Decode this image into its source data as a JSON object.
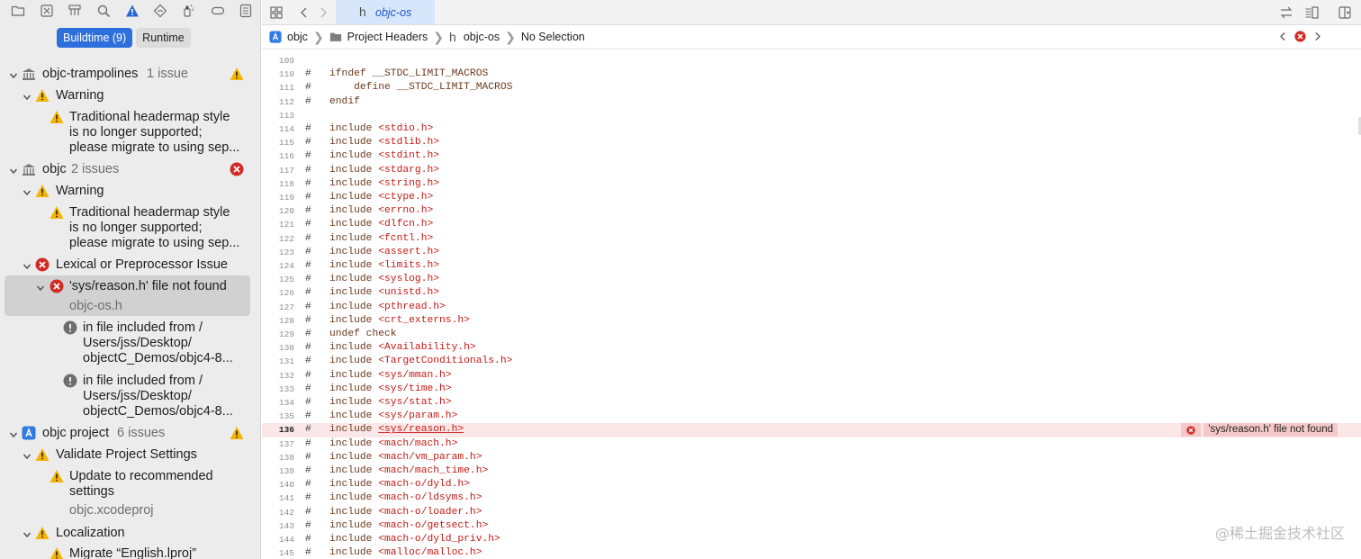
{
  "navigator": {
    "toolbar_icons": [
      "folder-icon",
      "close-box-icon",
      "hierarchy-icon",
      "search-icon",
      "warning-icon",
      "diamond-icon",
      "spray-icon",
      "tag-icon",
      "report-icon"
    ],
    "segments": [
      {
        "label": "Buildtime (9)",
        "selected": true
      },
      {
        "label": "Runtime",
        "selected": false
      }
    ],
    "groups": [
      {
        "title": "objc-trampolines",
        "count": "1 issue",
        "status": "warning"
      },
      {
        "title": "Warning"
      },
      {
        "lines": [
          "Traditional headermap style",
          "is no longer supported;",
          "please migrate to using sep..."
        ]
      },
      {
        "title": "objc",
        "count": "2 issues",
        "status": "error"
      },
      {
        "title": "Warning"
      },
      {
        "lines": [
          "Traditional headermap style",
          "is no longer supported;",
          "please migrate to using sep..."
        ]
      },
      {
        "title": "Lexical or Preprocessor Issue"
      },
      {
        "title": "'sys/reason.h' file not found",
        "file": "objc-os.h"
      },
      {
        "lines": [
          "in file included from /",
          "Users/jss/Desktop/",
          "objectC_Demos/objc4-8..."
        ]
      },
      {
        "lines": [
          "in file included from /",
          "Users/jss/Desktop/",
          "objectC_Demos/objc4-8..."
        ]
      },
      {
        "title": "objc project",
        "count": "6 issues",
        "status": "warning"
      },
      {
        "title": "Validate Project Settings"
      },
      {
        "lines": [
          "Update to recommended",
          "settings"
        ],
        "file": "objc.xcodeproj"
      },
      {
        "title": "Localization"
      },
      {
        "lines": [
          "Migrate “English.lproj”"
        ]
      }
    ]
  },
  "editor": {
    "tab_label": "objc-os",
    "tab_glyph": "h",
    "breadcrumb": [
      "objc",
      "Project Headers",
      "objc-os",
      "No Selection"
    ],
    "breadcrumb_glyph": "h",
    "lines": [
      {
        "n": "109",
        "hash": "",
        "pre": "",
        "hdr": ""
      },
      {
        "n": "110",
        "hash": "#",
        "pre": "ifndef __STDC_LIMIT_MACROS",
        "hdr": ""
      },
      {
        "n": "111",
        "hash": "#",
        "pre": "    define __STDC_LIMIT_MACROS",
        "hdr": ""
      },
      {
        "n": "112",
        "hash": "#",
        "pre": "endif",
        "hdr": ""
      },
      {
        "n": "113",
        "hash": "",
        "pre": "",
        "hdr": ""
      },
      {
        "n": "114",
        "hash": "#",
        "pre": "include ",
        "hdr": "<stdio.h>"
      },
      {
        "n": "115",
        "hash": "#",
        "pre": "include ",
        "hdr": "<stdlib.h>"
      },
      {
        "n": "116",
        "hash": "#",
        "pre": "include ",
        "hdr": "<stdint.h>"
      },
      {
        "n": "117",
        "hash": "#",
        "pre": "include ",
        "hdr": "<stdarg.h>"
      },
      {
        "n": "118",
        "hash": "#",
        "pre": "include ",
        "hdr": "<string.h>"
      },
      {
        "n": "119",
        "hash": "#",
        "pre": "include ",
        "hdr": "<ctype.h>"
      },
      {
        "n": "120",
        "hash": "#",
        "pre": "include ",
        "hdr": "<errno.h>"
      },
      {
        "n": "121",
        "hash": "#",
        "pre": "include ",
        "hdr": "<dlfcn.h>"
      },
      {
        "n": "122",
        "hash": "#",
        "pre": "include ",
        "hdr": "<fcntl.h>"
      },
      {
        "n": "123",
        "hash": "#",
        "pre": "include ",
        "hdr": "<assert.h>"
      },
      {
        "n": "124",
        "hash": "#",
        "pre": "include ",
        "hdr": "<limits.h>"
      },
      {
        "n": "125",
        "hash": "#",
        "pre": "include ",
        "hdr": "<syslog.h>"
      },
      {
        "n": "126",
        "hash": "#",
        "pre": "include ",
        "hdr": "<unistd.h>"
      },
      {
        "n": "127",
        "hash": "#",
        "pre": "include ",
        "hdr": "<pthread.h>"
      },
      {
        "n": "128",
        "hash": "#",
        "pre": "include ",
        "hdr": "<crt_externs.h>"
      },
      {
        "n": "129",
        "hash": "#",
        "pre": "undef check",
        "hdr": ""
      },
      {
        "n": "130",
        "hash": "#",
        "pre": "include ",
        "hdr": "<Availability.h>"
      },
      {
        "n": "131",
        "hash": "#",
        "pre": "include ",
        "hdr": "<TargetConditionals.h>"
      },
      {
        "n": "132",
        "hash": "#",
        "pre": "include ",
        "hdr": "<sys/mman.h>"
      },
      {
        "n": "133",
        "hash": "#",
        "pre": "include ",
        "hdr": "<sys/time.h>"
      },
      {
        "n": "134",
        "hash": "#",
        "pre": "include ",
        "hdr": "<sys/stat.h>"
      },
      {
        "n": "135",
        "hash": "#",
        "pre": "include ",
        "hdr": "<sys/param.h>"
      },
      {
        "n": "136",
        "hash": "#",
        "pre": "include ",
        "hdr": "<sys/reason.h>",
        "error": true
      },
      {
        "n": "137",
        "hash": "#",
        "pre": "include ",
        "hdr": "<mach/mach.h>"
      },
      {
        "n": "138",
        "hash": "#",
        "pre": "include ",
        "hdr": "<mach/vm_param.h>"
      },
      {
        "n": "139",
        "hash": "#",
        "pre": "include ",
        "hdr": "<mach/mach_time.h>"
      },
      {
        "n": "140",
        "hash": "#",
        "pre": "include ",
        "hdr": "<mach-o/dyld.h>"
      },
      {
        "n": "141",
        "hash": "#",
        "pre": "include ",
        "hdr": "<mach-o/ldsyms.h>"
      },
      {
        "n": "142",
        "hash": "#",
        "pre": "include ",
        "hdr": "<mach-o/loader.h>"
      },
      {
        "n": "143",
        "hash": "#",
        "pre": "include ",
        "hdr": "<mach-o/getsect.h>"
      },
      {
        "n": "144",
        "hash": "#",
        "pre": "include ",
        "hdr": "<mach-o/dyld_priv.h>"
      },
      {
        "n": "145",
        "hash": "#",
        "pre": "include ",
        "hdr": "<malloc/malloc.h>"
      }
    ],
    "error_message": "'sys/reason.h' file not found"
  },
  "watermark": "@稀土掘金技术社区",
  "colors": {
    "accent": "#2f6fdb",
    "error": "#d22b26",
    "warning": "#f5b400"
  }
}
